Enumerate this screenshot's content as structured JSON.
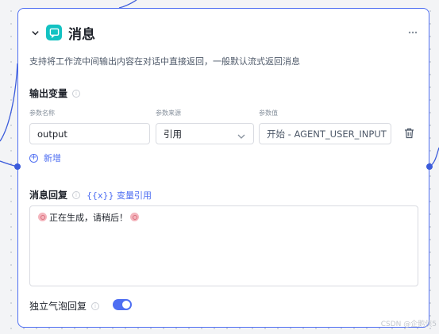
{
  "node": {
    "title": "消息",
    "icon": "chat-bubble-icon",
    "description": "支持将工作流中间输出内容在对话中直接返回，一般默认流式返回消息"
  },
  "output_section": {
    "title": "输出变量",
    "columns": {
      "name": "参数名称",
      "source": "参数来源",
      "value": "参数值"
    },
    "rows": [
      {
        "name": "output",
        "source": "引用",
        "value": "开始 - AGENT_USER_INPUT"
      }
    ],
    "add_label": "新增"
  },
  "message_section": {
    "title": "消息回复",
    "variable_ref_label": "{{x}} 变量引用",
    "content": "正在生成，请稍后！"
  },
  "bubble_section": {
    "title": "独立气泡回复",
    "enabled": true
  },
  "watermark": "CSDN @企鹅侠5",
  "colors": {
    "accent": "#4e6ef2",
    "node_icon_bg": "#13c2c2",
    "port": "#3b5bdb"
  }
}
